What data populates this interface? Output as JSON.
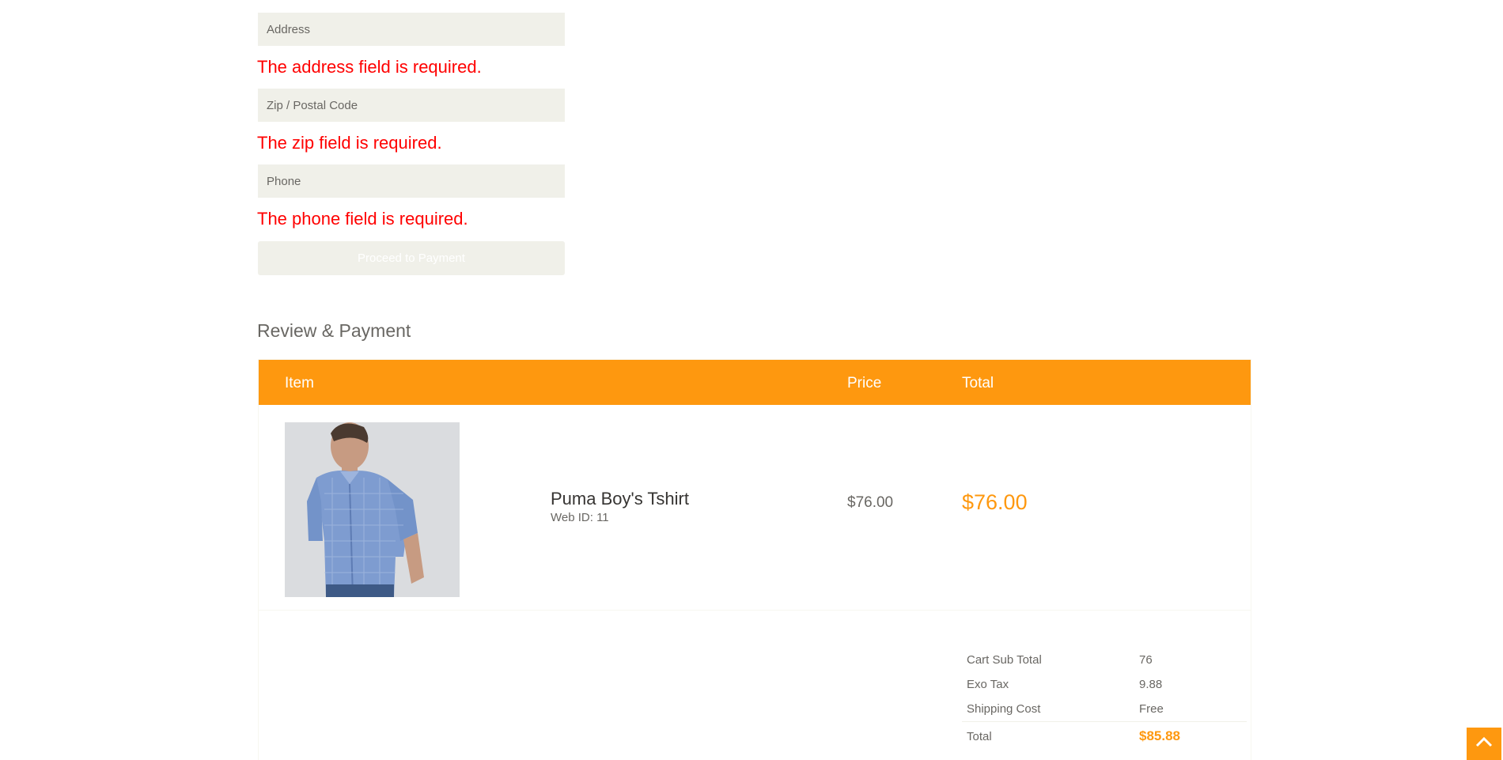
{
  "form": {
    "address_placeholder": "Address",
    "address_error": "The address field is required.",
    "zip_placeholder": "Zip / Postal Code",
    "zip_error": "The zip field is required.",
    "phone_placeholder": "Phone",
    "phone_error": "The phone field is required.",
    "proceed_label": "Proceed to Payment"
  },
  "review": {
    "title": "Review & Payment",
    "columns": {
      "item": "Item",
      "price": "Price",
      "total": "Total"
    },
    "items": [
      {
        "name": "Puma Boy's Tshirt",
        "web_id": "Web ID: 11",
        "price": "$76.00",
        "total": "$76.00"
      }
    ],
    "summary": {
      "sub_total_label": "Cart Sub Total",
      "sub_total_value": "76",
      "tax_label": "Exo Tax",
      "tax_value": "9.88",
      "shipping_label": "Shipping Cost",
      "shipping_value": "Free",
      "total_label": "Total",
      "total_value": "$85.88"
    }
  },
  "colors": {
    "accent": "#FE980F",
    "error": "#FF0000",
    "field_bg": "#F0F0E9",
    "text": "#696763"
  },
  "icons": {
    "scroll_up": "chevron-up-icon"
  }
}
